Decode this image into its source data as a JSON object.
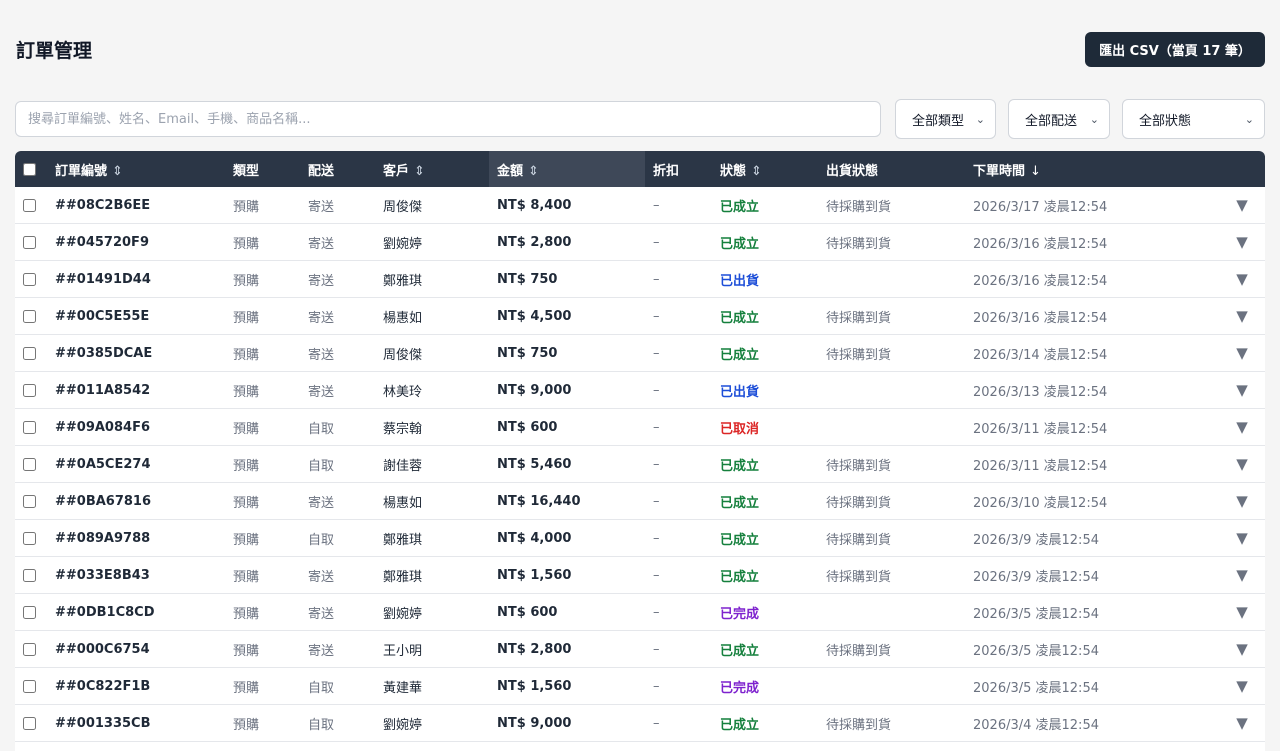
{
  "header": {
    "title": "訂單管理",
    "export_label": "匯出 CSV（當頁 17 筆）"
  },
  "filters": {
    "search_placeholder": "搜尋訂單編號、姓名、Email、手機、商品名稱...",
    "type_value": "全部類型",
    "shipping_value": "全部配送",
    "status_value": "全部狀態"
  },
  "table": {
    "columns": {
      "order_id": "訂單編號",
      "type": "類型",
      "shipping": "配送",
      "customer": "客戶",
      "amount": "金額",
      "discount": "折扣",
      "status": "狀態",
      "fulfillment": "出貨狀態",
      "created": "下單時間"
    },
    "sort_icon": "⇕",
    "sort_desc_icon": "↓",
    "expand_icon": "▼",
    "rows": [
      {
        "id": "##08C2B6EE",
        "type": "預購",
        "shipping": "寄送",
        "customer": "周俊傑",
        "amount": "NT$ 8,400",
        "discount": "–",
        "status": "已成立",
        "status_color": "green",
        "fulfillment": "待採購到貨",
        "created": "2026/3/17 凌晨12:54"
      },
      {
        "id": "##045720F9",
        "type": "預購",
        "shipping": "寄送",
        "customer": "劉婉婷",
        "amount": "NT$ 2,800",
        "discount": "–",
        "status": "已成立",
        "status_color": "green",
        "fulfillment": "待採購到貨",
        "created": "2026/3/16 凌晨12:54"
      },
      {
        "id": "##01491D44",
        "type": "預購",
        "shipping": "寄送",
        "customer": "鄭雅琪",
        "amount": "NT$ 750",
        "discount": "–",
        "status": "已出貨",
        "status_color": "blue",
        "fulfillment": "",
        "created": "2026/3/16 凌晨12:54"
      },
      {
        "id": "##00C5E55E",
        "type": "預購",
        "shipping": "寄送",
        "customer": "楊惠如",
        "amount": "NT$ 4,500",
        "discount": "–",
        "status": "已成立",
        "status_color": "green",
        "fulfillment": "待採購到貨",
        "created": "2026/3/16 凌晨12:54"
      },
      {
        "id": "##0385DCAE",
        "type": "預購",
        "shipping": "寄送",
        "customer": "周俊傑",
        "amount": "NT$ 750",
        "discount": "–",
        "status": "已成立",
        "status_color": "green",
        "fulfillment": "待採購到貨",
        "created": "2026/3/14 凌晨12:54"
      },
      {
        "id": "##011A8542",
        "type": "預購",
        "shipping": "寄送",
        "customer": "林美玲",
        "amount": "NT$ 9,000",
        "discount": "–",
        "status": "已出貨",
        "status_color": "blue",
        "fulfillment": "",
        "created": "2026/3/13 凌晨12:54"
      },
      {
        "id": "##09A084F6",
        "type": "預購",
        "shipping": "自取",
        "customer": "蔡宗翰",
        "amount": "NT$ 600",
        "discount": "–",
        "status": "已取消",
        "status_color": "red",
        "fulfillment": "",
        "created": "2026/3/11 凌晨12:54"
      },
      {
        "id": "##0A5CE274",
        "type": "預購",
        "shipping": "自取",
        "customer": "謝佳蓉",
        "amount": "NT$ 5,460",
        "discount": "–",
        "status": "已成立",
        "status_color": "green",
        "fulfillment": "待採購到貨",
        "created": "2026/3/11 凌晨12:54"
      },
      {
        "id": "##0BA67816",
        "type": "預購",
        "shipping": "寄送",
        "customer": "楊惠如",
        "amount": "NT$ 16,440",
        "discount": "–",
        "status": "已成立",
        "status_color": "green",
        "fulfillment": "待採購到貨",
        "created": "2026/3/10 凌晨12:54"
      },
      {
        "id": "##089A9788",
        "type": "預購",
        "shipping": "自取",
        "customer": "鄭雅琪",
        "amount": "NT$ 4,000",
        "discount": "–",
        "status": "已成立",
        "status_color": "green",
        "fulfillment": "待採購到貨",
        "created": "2026/3/9 凌晨12:54"
      },
      {
        "id": "##033E8B43",
        "type": "預購",
        "shipping": "寄送",
        "customer": "鄭雅琪",
        "amount": "NT$ 1,560",
        "discount": "–",
        "status": "已成立",
        "status_color": "green",
        "fulfillment": "待採購到貨",
        "created": "2026/3/9 凌晨12:54"
      },
      {
        "id": "##0DB1C8CD",
        "type": "預購",
        "shipping": "寄送",
        "customer": "劉婉婷",
        "amount": "NT$ 600",
        "discount": "–",
        "status": "已完成",
        "status_color": "purple",
        "fulfillment": "",
        "created": "2026/3/5 凌晨12:54"
      },
      {
        "id": "##000C6754",
        "type": "預購",
        "shipping": "寄送",
        "customer": "王小明",
        "amount": "NT$ 2,800",
        "discount": "–",
        "status": "已成立",
        "status_color": "green",
        "fulfillment": "待採購到貨",
        "created": "2026/3/5 凌晨12:54"
      },
      {
        "id": "##0C822F1B",
        "type": "預購",
        "shipping": "自取",
        "customer": "黃建華",
        "amount": "NT$ 1,560",
        "discount": "–",
        "status": "已完成",
        "status_color": "purple",
        "fulfillment": "",
        "created": "2026/3/5 凌晨12:54"
      },
      {
        "id": "##001335CB",
        "type": "預購",
        "shipping": "自取",
        "customer": "劉婉婷",
        "amount": "NT$ 9,000",
        "discount": "–",
        "status": "已成立",
        "status_color": "green",
        "fulfillment": "待採購到貨",
        "created": "2026/3/4 凌晨12:54"
      }
    ]
  }
}
